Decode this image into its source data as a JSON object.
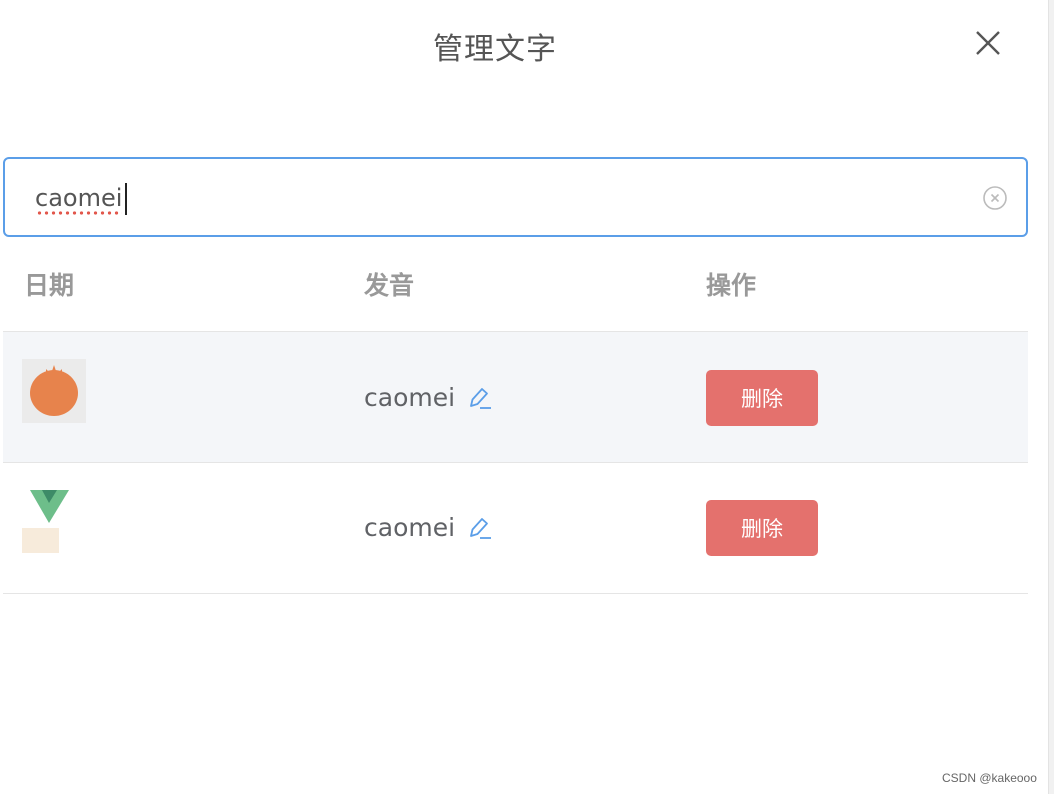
{
  "dialog": {
    "title": "管理文字"
  },
  "search": {
    "value": "caomei"
  },
  "table": {
    "headers": [
      "日期",
      "发音",
      "操作"
    ],
    "rows": [
      {
        "image": "pomegranate-icon",
        "pronunciation": "caomei",
        "delete_label": "删除"
      },
      {
        "image": "vue-logo-icon",
        "pronunciation": "caomei",
        "delete_label": "删除"
      }
    ]
  },
  "colors": {
    "accent": "#5b9ee8",
    "danger": "#e4716d",
    "row_highlight": "#f4f6f9"
  },
  "watermark": "CSDN @kakeooo"
}
